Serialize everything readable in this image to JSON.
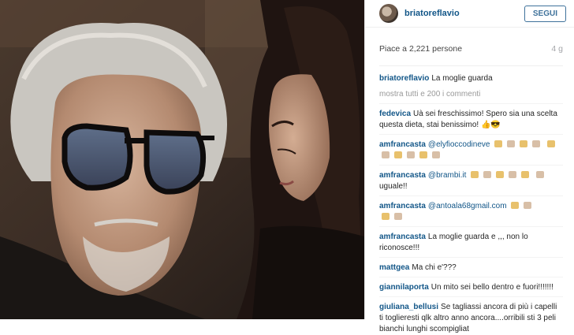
{
  "post": {
    "username": "briatoreflavio",
    "follow_label": "SEGUI",
    "likes_text": "Piace a 2,221 persone",
    "age": "4 g",
    "caption_user": "briatoreflavio",
    "caption_text": "La moglie guarda",
    "show_all": "mostra tutti e 200 i commenti"
  },
  "comments": [
    {
      "user": "fedevica",
      "text": "Uà sei freschissimo! Spero sia una scelta questa dieta, stai benissimo! 👍😎"
    },
    {
      "user": "amfrancasta",
      "text": "@elyfioccodineve"
    },
    {
      "user": "amfrancasta",
      "text": "@brambi.it"
    },
    {
      "user": "amfrancasta",
      "text_after": "uguale!!"
    },
    {
      "user": "amfrancasta",
      "text": "@antoala68gmail.com"
    },
    {
      "user": "amfrancasta",
      "text": "La moglie guarda e ,,, non lo riconosce!!!"
    },
    {
      "user": "mattgea",
      "text": "Ma chi e'???"
    },
    {
      "user": "giannilaporta",
      "text": "Un mito sei bello dentro e fuori!!!!!!!"
    },
    {
      "user": "giuliana_bellusi",
      "text": "Se tagliassi ancora di più i capelli ti toglieresti qlk altro anno ancora....orribili sti 3 peli bianchi lunghi scompigliat"
    }
  ]
}
